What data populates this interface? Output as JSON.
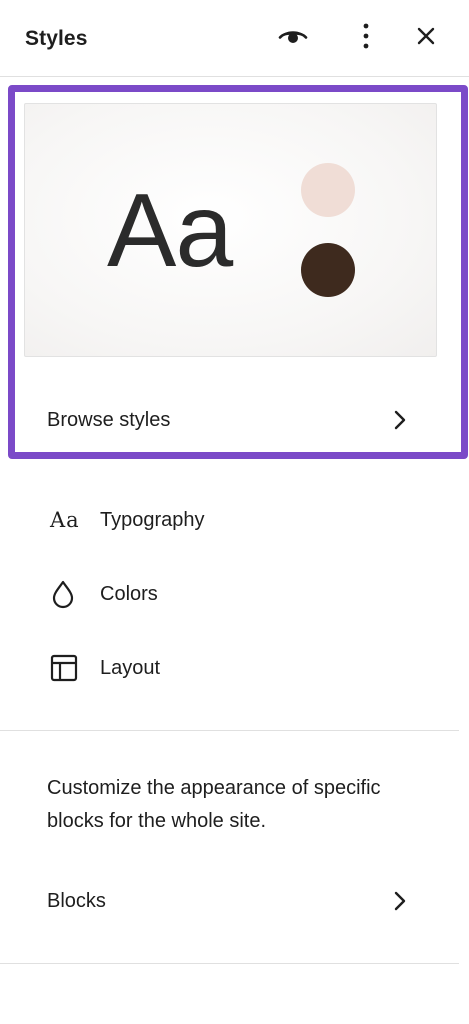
{
  "header": {
    "title": "Styles",
    "icons": [
      "eye-icon",
      "more-vertical-icon",
      "close-icon"
    ]
  },
  "preview": {
    "sample_text": "Aa",
    "swatches": [
      "#f0ddd6",
      "#3e2a1e"
    ]
  },
  "browse": {
    "label": "Browse styles"
  },
  "nav": {
    "items": [
      {
        "label": "Typography",
        "icon": "typography-icon",
        "glyph": "Aa"
      },
      {
        "label": "Colors",
        "icon": "droplet-icon"
      },
      {
        "label": "Layout",
        "icon": "layout-icon"
      }
    ]
  },
  "blocks_section": {
    "description": "Customize the appearance of specific blocks for the whole site.",
    "label": "Blocks"
  },
  "colors": {
    "accent": "#7b4ac8",
    "text": "#1e1e1e",
    "divider": "#e0e0e0"
  }
}
